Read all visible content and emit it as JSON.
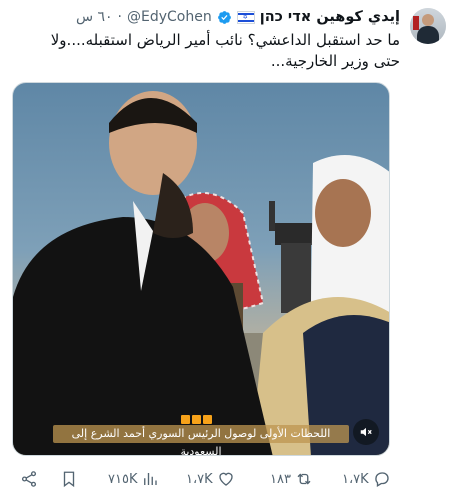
{
  "tweet": {
    "author_name": "إيدي كوهين אדי כהן",
    "handle": "@EdyCohen",
    "separator": "·",
    "time": "٦٠ س",
    "text_line1": "ما حد استقبل الداعشي؟ نائب أمير الرياض استقبله....ولا",
    "text_line2": "حتى وزير الخارجية..."
  },
  "media": {
    "caption": "اللحظات الأولى لوصول الرئيس السوري أحمد الشرع إلى السعودية"
  },
  "actions": {
    "reply_count": "١،٧K",
    "retweet_count": "١٨٣",
    "like_count": "١،٧K",
    "views_count": "٧١٥K"
  },
  "colors": {
    "verified": "#1d9bf0",
    "muted_text": "#536471",
    "caption_bg": "#be9650"
  }
}
